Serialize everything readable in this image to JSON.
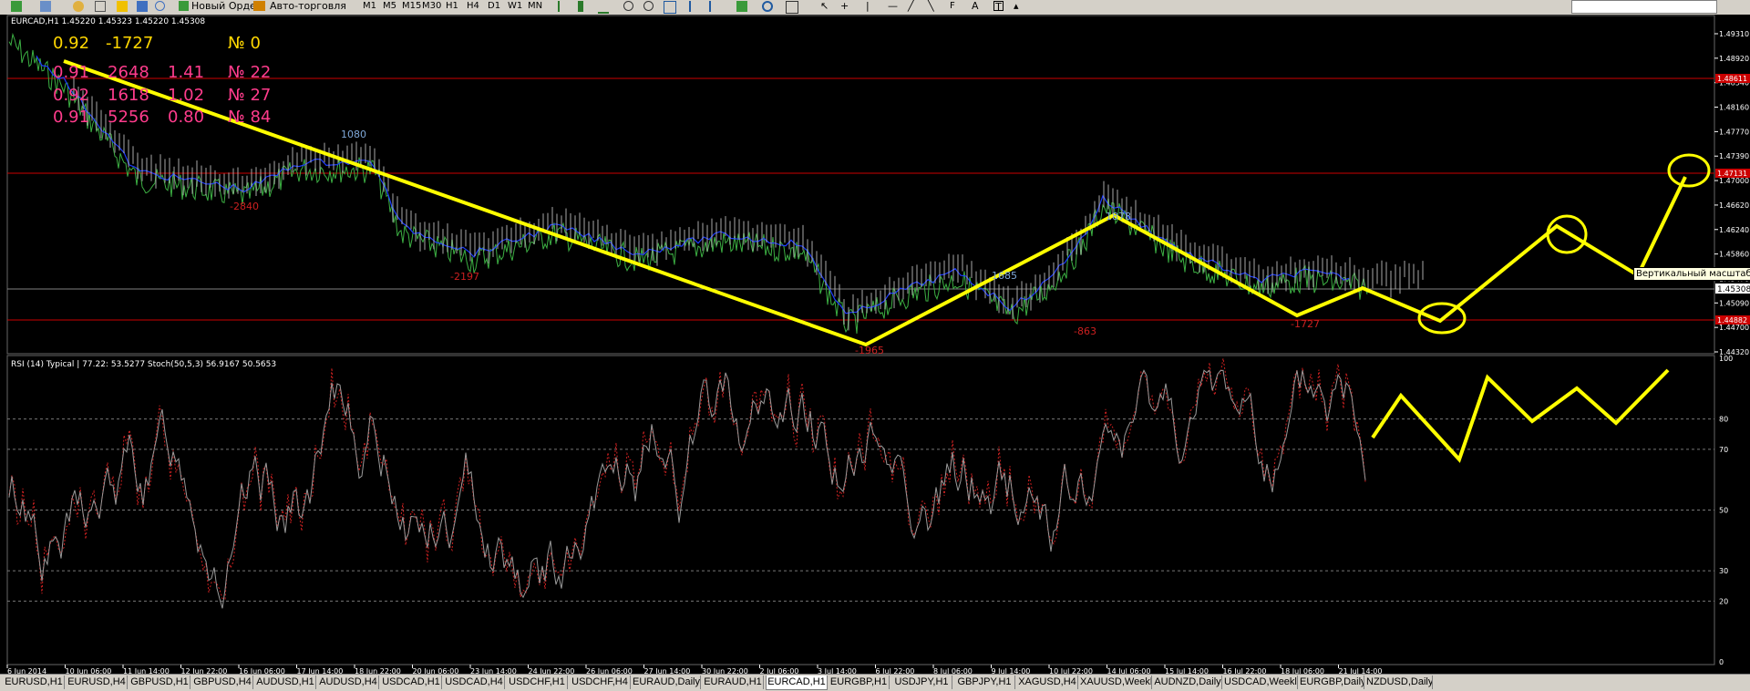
{
  "toolbar": {
    "new_order_label": "Новый Ордер",
    "autotrading_label": "Авто-торговля",
    "timeframes": [
      "M1",
      "M5",
      "M15",
      "M30",
      "H1",
      "H4",
      "D1",
      "W1",
      "MN"
    ],
    "search_value": ""
  },
  "main_chart": {
    "title": "EURCAD,H1  1.45220 1.45323 1.45220 1.45308",
    "stats_line1": {
      "a": "0.92",
      "b": "-1727",
      "c": "№ 0"
    },
    "stats_rows": [
      {
        "a": "0.91",
        "b": "2648",
        "c": "1.41",
        "d": "№ 22"
      },
      {
        "a": "0.92",
        "b": "1618",
        "c": "1.02",
        "d": "№ 27"
      },
      {
        "a": "0.91",
        "b": "5256",
        "c": "0.80",
        "d": "№ 84"
      }
    ],
    "zigzag_labels": [
      "1080",
      "-2840",
      "-2197",
      "-1965",
      "1685",
      "1878",
      "-863",
      "-1727"
    ],
    "price_ticks": [
      "1.49310",
      "1.48920",
      "1.48540",
      "1.48160",
      "1.47770",
      "1.47390",
      "1.47000",
      "1.46620",
      "1.46240",
      "1.45860",
      "1.45470",
      "1.45090",
      "1.44700",
      "1.44320"
    ],
    "current_price": "1.45308",
    "level_prices": [
      "1.48611",
      "1.47131",
      "1.44882"
    ],
    "colors": {
      "price": "#3cb043",
      "zigzag": "#ffff00",
      "level": "#cc0000",
      "stats_yellow": "#ffd700",
      "stats_pink": "#ff3c8c",
      "axis": "#ffffff"
    }
  },
  "indicator": {
    "title": "RSI (14) Typical | 77.22: 53.5277  Stoch(50,5,3) 56.9167 50.5653",
    "levels": [
      "100",
      "80",
      "70",
      "50",
      "30",
      "20",
      "0"
    ]
  },
  "time_labels": [
    "6 Jun 2014",
    "10 Jun 06:00",
    "11 Jun 14:00",
    "12 Jun 22:00",
    "16 Jun 06:00",
    "17 Jun 14:00",
    "18 Jun 22:00",
    "20 Jun 06:00",
    "23 Jun 14:00",
    "24 Jun 22:00",
    "26 Jun 06:00",
    "27 Jun 14:00",
    "30 Jun 22:00",
    "2 Jul 06:00",
    "3 Jul 14:00",
    "6 Jul 22:00",
    "8 Jul 06:00",
    "9 Jul 14:00",
    "10 Jul 22:00",
    "14 Jul 06:00",
    "15 Jul 14:00",
    "16 Jul 22:00",
    "18 Jul 06:00",
    "21 Jul 14:00"
  ],
  "tooltip": "Вертикальный масштаб",
  "tabs": [
    {
      "label": "EURUSD,H1",
      "active": false
    },
    {
      "label": "EURUSD,H4",
      "active": false
    },
    {
      "label": "GBPUSD,H1",
      "active": false
    },
    {
      "label": "GBPUSD,H4",
      "active": false
    },
    {
      "label": "AUDUSD,H1",
      "active": false
    },
    {
      "label": "AUDUSD,H4",
      "active": false
    },
    {
      "label": "USDCAD,H1",
      "active": false
    },
    {
      "label": "USDCAD,H4",
      "active": false
    },
    {
      "label": "USDCHF,H1",
      "active": false
    },
    {
      "label": "USDCHF,H4",
      "active": false
    },
    {
      "label": "EURAUD,Daily",
      "active": false
    },
    {
      "label": "EURAUD,H1",
      "active": false
    },
    {
      "label": "EURCAD,H1",
      "active": true
    },
    {
      "label": "EURGBP,H1",
      "active": false
    },
    {
      "label": "USDJPY,H1",
      "active": false
    },
    {
      "label": "GBPJPY,H1",
      "active": false
    },
    {
      "label": "XAGUSD,H4",
      "active": false
    },
    {
      "label": "XAUUSD,Weekly",
      "active": false
    },
    {
      "label": "AUDNZD,Daily",
      "active": false
    },
    {
      "label": "USDCAD,Weekly",
      "active": false
    },
    {
      "label": "EURGBP,Daily",
      "active": false
    },
    {
      "label": "NZDUSD,Daily",
      "active": false
    }
  ]
}
